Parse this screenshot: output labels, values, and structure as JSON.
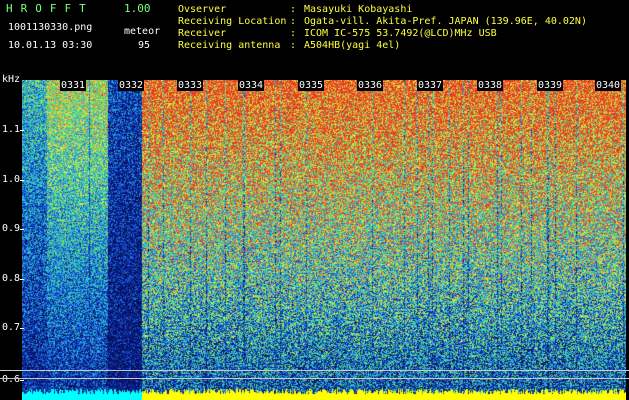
{
  "header": {
    "brand": "HROFFT",
    "version": "1.00",
    "filename": "1001130330.png",
    "datetime": "10.01.13 03:30",
    "meteor_label": "meteor",
    "meteor_count": "95"
  },
  "info": [
    {
      "label": "Ovserver",
      "value": "Masayuki Kobayashi"
    },
    {
      "label": "Receiving Location",
      "value": "Ogata-vill. Akita-Pref. JAPAN (139.96E, 40.02N)"
    },
    {
      "label": "Receiver",
      "value": "ICOM IC-575 53.7492(@LCD)MHz USB"
    },
    {
      "label": "Receiving antenna",
      "value": "A504HB(yagi 4el)"
    }
  ],
  "colon": ":",
  "axis": {
    "unit": "kHz",
    "yticks": [
      "1.1",
      "1.0",
      "0.9",
      "0.8",
      "0.7",
      "0.6"
    ],
    "time_labels": [
      "0331",
      "0332",
      "0333",
      "0334",
      "0335",
      "0336",
      "0337",
      "0338",
      "0339",
      "0340"
    ]
  },
  "colors": {
    "background": "#000000",
    "header_green": "#7cff7c",
    "header_yellow": "#ffff40",
    "axis_white": "#ffffff",
    "baseline_yellow": "#ffff00",
    "baseline_cyan": "#00ffff"
  }
}
